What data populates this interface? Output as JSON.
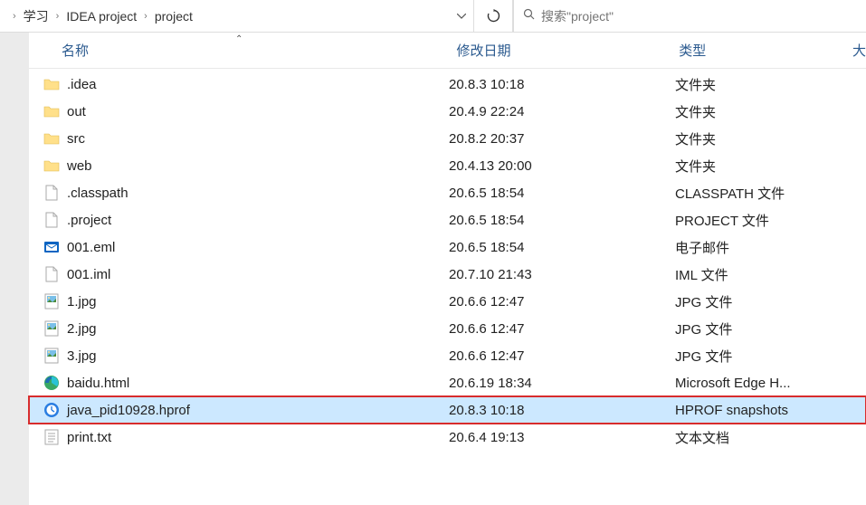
{
  "breadcrumb": {
    "items": [
      "学习",
      "IDEA project",
      "project"
    ]
  },
  "search": {
    "placeholder": "搜索\"project\""
  },
  "columns": {
    "name": "名称",
    "date": "修改日期",
    "type": "类型",
    "size": "大"
  },
  "files": [
    {
      "icon": "folder",
      "name": ".idea",
      "date": "20.8.3 10:18",
      "type": "文件夹"
    },
    {
      "icon": "folder",
      "name": "out",
      "date": "20.4.9 22:24",
      "type": "文件夹"
    },
    {
      "icon": "folder",
      "name": "src",
      "date": "20.8.2 20:37",
      "type": "文件夹"
    },
    {
      "icon": "folder",
      "name": "web",
      "date": "20.4.13 20:00",
      "type": "文件夹"
    },
    {
      "icon": "file",
      "name": ".classpath",
      "date": "20.6.5 18:54",
      "type": "CLASSPATH 文件"
    },
    {
      "icon": "file",
      "name": ".project",
      "date": "20.6.5 18:54",
      "type": "PROJECT 文件"
    },
    {
      "icon": "eml",
      "name": "001.eml",
      "date": "20.6.5 18:54",
      "type": "电子邮件"
    },
    {
      "icon": "file",
      "name": "001.iml",
      "date": "20.7.10 21:43",
      "type": "IML 文件"
    },
    {
      "icon": "image",
      "name": "1.jpg",
      "date": "20.6.6 12:47",
      "type": "JPG 文件"
    },
    {
      "icon": "image",
      "name": "2.jpg",
      "date": "20.6.6 12:47",
      "type": "JPG 文件"
    },
    {
      "icon": "image",
      "name": "3.jpg",
      "date": "20.6.6 12:47",
      "type": "JPG 文件"
    },
    {
      "icon": "edge",
      "name": "baidu.html",
      "date": "20.6.19 18:34",
      "type": "Microsoft Edge H..."
    },
    {
      "icon": "hprof",
      "name": "java_pid10928.hprof",
      "date": "20.8.3 10:18",
      "type": "HPROF snapshots",
      "selected": true,
      "highlighted": true
    },
    {
      "icon": "text",
      "name": "print.txt",
      "date": "20.6.4 19:13",
      "type": "文本文档"
    }
  ]
}
